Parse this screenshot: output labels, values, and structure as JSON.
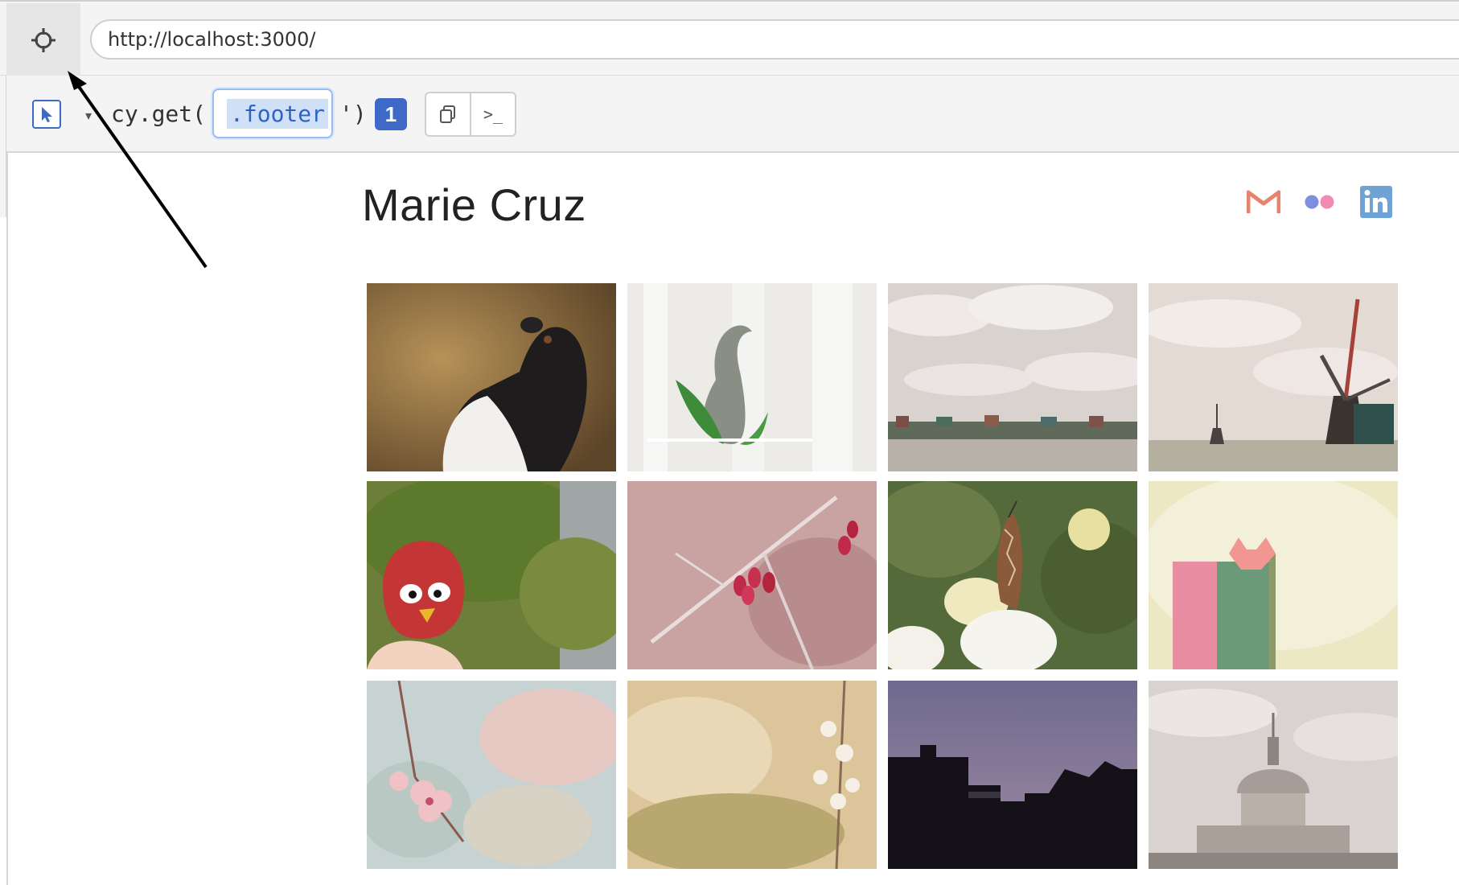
{
  "browser": {
    "url": "http://localhost:3000/"
  },
  "selector_playground": {
    "command_prefix": "cy.get('",
    "selector": ".footer",
    "command_suffix": "')",
    "match_count": "1",
    "copy_icon": "copy-icon",
    "console_icon": "console-icon",
    "console_glyph": ">_"
  },
  "site": {
    "title": "Marie Cruz",
    "social": [
      {
        "name": "gmail-icon",
        "color": "#e8836f"
      },
      {
        "name": "flickr-icon",
        "color": "#f28bb1"
      },
      {
        "name": "linkedin-icon",
        "color": "#6fa3d6"
      }
    ]
  },
  "gallery": {
    "photos": [
      {
        "subject": "dog"
      },
      {
        "subject": "origami-swan"
      },
      {
        "subject": "village-riverside"
      },
      {
        "subject": "windmills"
      },
      {
        "subject": "origami-bird"
      },
      {
        "subject": "red-berries-branch"
      },
      {
        "subject": "butterfly-on-flowers"
      },
      {
        "subject": "origami-cat-bookmark"
      },
      {
        "subject": "cherry-blossom"
      },
      {
        "subject": "blossom-branch"
      },
      {
        "subject": "silhouette-buildings"
      },
      {
        "subject": "st-pauls-cathedral"
      }
    ]
  }
}
